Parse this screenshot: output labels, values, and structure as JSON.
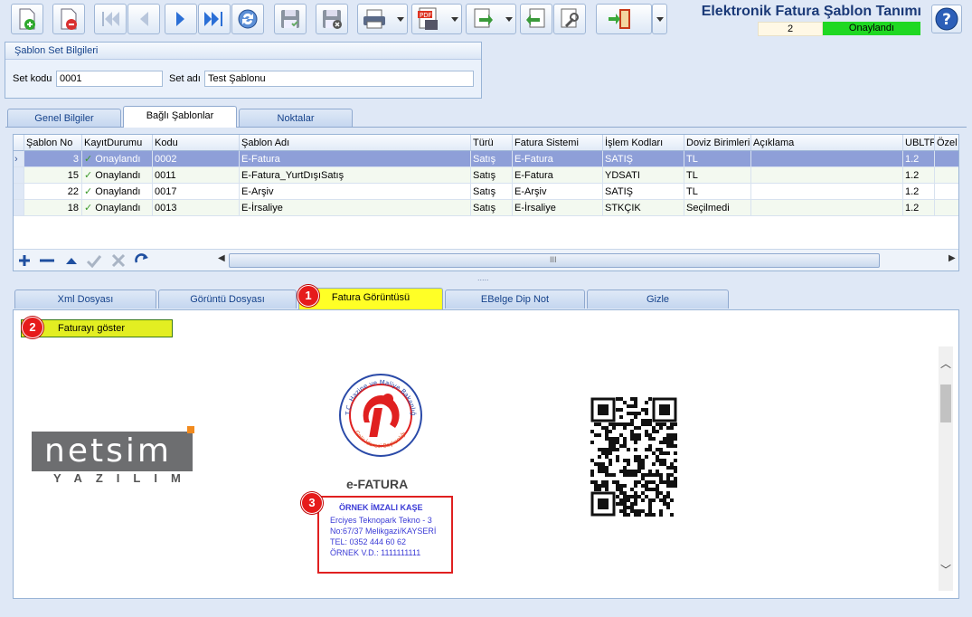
{
  "toolbar": {
    "buttons": [
      "new-icon",
      "delete-icon",
      "first-icon",
      "prev-icon",
      "next-icon",
      "last-icon",
      "refresh-icon",
      "save-icon",
      "cancel-save-icon",
      "print-icon",
      "pdf-icon",
      "export-icon",
      "import-icon",
      "tools-icon",
      "exit-icon",
      "help-icon"
    ]
  },
  "header": {
    "title": "Elektronik Fatura Şablon Tanımı",
    "count": "2",
    "status": "Onaylandı"
  },
  "set_group": {
    "title": "Şablon Set Bilgileri",
    "code_label": "Set kodu",
    "code_value": "0001",
    "name_label": "Set adı",
    "name_value": "Test Şablonu"
  },
  "top_tabs": [
    "Genel Bilgiler",
    "Bağlı Şablonlar",
    "Noktalar"
  ],
  "grid": {
    "headers": [
      "Şablon No",
      "KayıtDurumu",
      "Kodu",
      "Şablon Adı",
      "Türü",
      "Fatura Sistemi",
      "İşlem Kodları",
      "Doviz Birimleri",
      "Açıklama",
      "UBLTR",
      "Özel"
    ],
    "rows": [
      [
        "3",
        "Onaylandı",
        "0002",
        "E-Fatura",
        "Satış",
        "E-Fatura",
        "SATIŞ",
        "TL",
        "",
        "1.2"
      ],
      [
        "15",
        "Onaylandı",
        "0011",
        "E-Fatura_YurtDışıSatış",
        "Satış",
        "E-Fatura",
        "YDSATI",
        "TL",
        "",
        "1.2"
      ],
      [
        "22",
        "Onaylandı",
        "0017",
        "E-Arşiv",
        "Satış",
        "E-Arşiv",
        "SATIŞ",
        "TL",
        "",
        "1.2"
      ],
      [
        "18",
        "Onaylandı",
        "0013",
        "E-İrsaliye",
        "Satış",
        "E-İrsaliye",
        "STKÇIK",
        "Seçilmedi",
        "",
        "1.2"
      ]
    ],
    "scroll_mark": "III",
    "splitter": "....."
  },
  "bottom_tabs": [
    "Xml Dosyası",
    "Görüntü Dosyası",
    "Fatura Görüntüsü",
    "EBelge Dip Not",
    "Gizle"
  ],
  "show_button": "Faturayı göster",
  "callouts": [
    "1",
    "2",
    "3"
  ],
  "invoice": {
    "brand_name": "netsim",
    "brand_sub": "YAZILIM",
    "seal_text": "T.C. Hazine ve Maliye Bakanlığı · Gelir İdaresi Başkanlığı",
    "doc_type": "e-FATURA",
    "stamp_title": "ÖRNEK İMZALI KAŞE",
    "stamp_lines": [
      "Erciyes Teknopark Tekno - 3",
      "No:67/37 Melikgazi/KAYSERİ",
      "TEL: 0352 444 60 62",
      "ÖRNEK V.D.: 1111111111"
    ]
  },
  "colors": {
    "accent": "#15428b",
    "approved": "#1fd822",
    "highlight": "#ffff26",
    "selected_row": "#8e9fd8",
    "callout": "#e61b1b"
  }
}
